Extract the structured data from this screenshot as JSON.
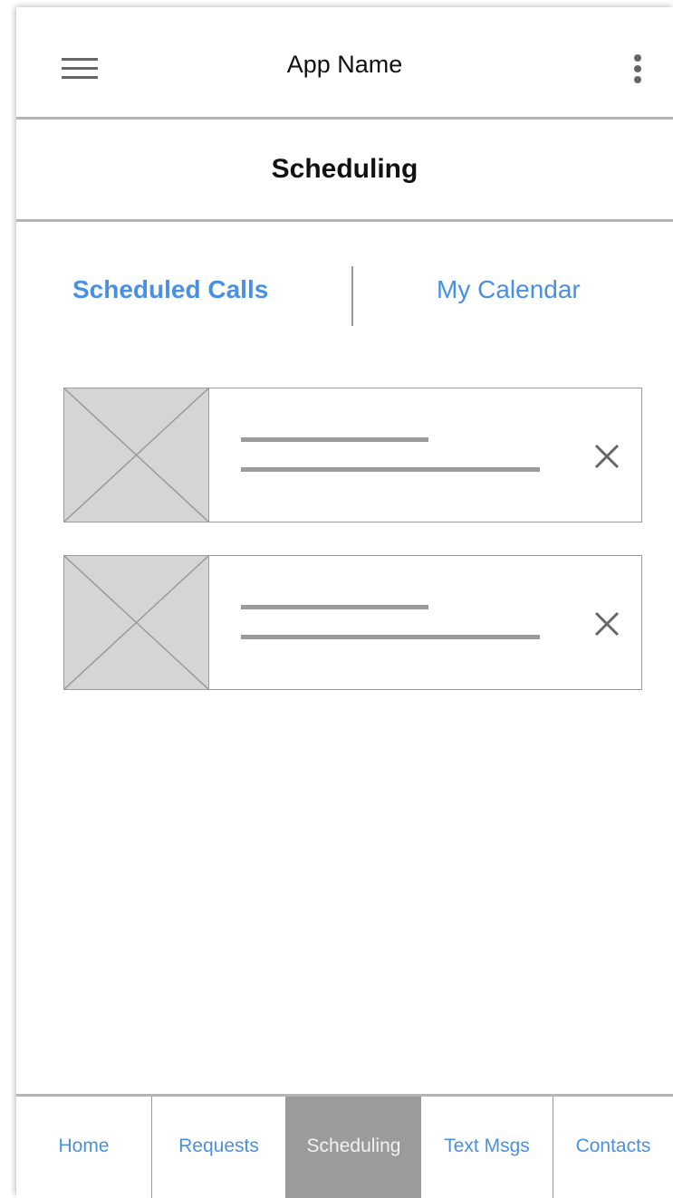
{
  "app_bar": {
    "title": "App Name",
    "menu_icon": "hamburger-menu-icon",
    "overflow_icon": "more-vertical-icon"
  },
  "page": {
    "title": "Scheduling"
  },
  "tabs": [
    {
      "label": "Scheduled Calls",
      "active": true
    },
    {
      "label": "My Calendar",
      "active": false
    }
  ],
  "list": {
    "item_count": 2,
    "thumbnail_icon": "image-placeholder-icon",
    "remove_icon": "close-icon"
  },
  "bottom_nav": {
    "items": [
      {
        "label": "Home"
      },
      {
        "label": "Requests"
      },
      {
        "label": "Scheduling",
        "selected": true
      },
      {
        "label": "Text Msgs"
      },
      {
        "label": "Contacts"
      }
    ]
  },
  "colors": {
    "accent": "#4a90e2",
    "divider": "#b5b5b5",
    "placeholder_fill": "#d5d5d5",
    "selected_nav_bg": "#9b9b9b",
    "icon_gray": "#666666"
  }
}
